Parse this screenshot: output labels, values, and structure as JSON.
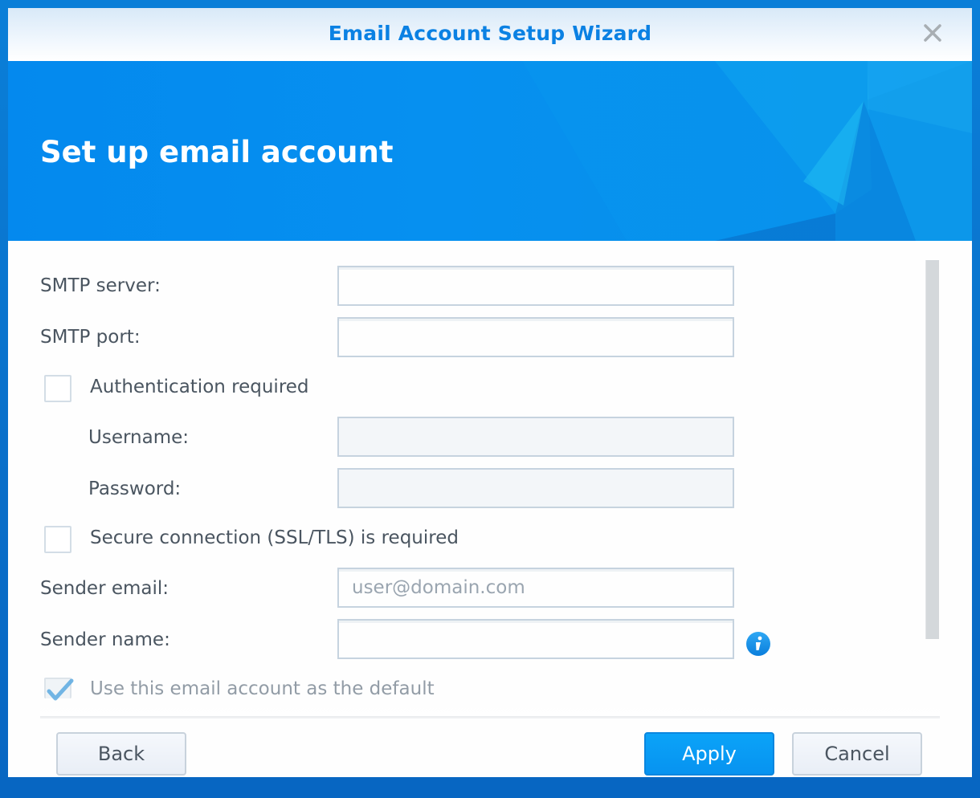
{
  "window": {
    "title": "Email Account Setup Wizard",
    "close_icon": "close-icon"
  },
  "banner": {
    "heading": "Set up email account"
  },
  "form": {
    "smtp_server": {
      "label": "SMTP server:",
      "value": "",
      "placeholder": ""
    },
    "smtp_port": {
      "label": "SMTP port:",
      "value": "",
      "placeholder": ""
    },
    "auth_required": {
      "label": "Authentication required",
      "checked": false
    },
    "username": {
      "label": "Username:",
      "value": "",
      "disabled": true
    },
    "password": {
      "label": "Password:",
      "value": "",
      "disabled": true
    },
    "ssl_required": {
      "label": "Secure connection (SSL/TLS) is required",
      "checked": false
    },
    "sender_email": {
      "label": "Sender email:",
      "value": "",
      "placeholder": "user@domain.com"
    },
    "sender_name": {
      "label": "Sender name:",
      "value": "",
      "placeholder": "",
      "info_icon": "info-icon"
    },
    "use_default": {
      "label": "Use this email account as the default",
      "checked": true,
      "disabled": true
    }
  },
  "footer": {
    "back_label": "Back",
    "apply_label": "Apply",
    "cancel_label": "Cancel"
  },
  "colors": {
    "accent": "#0b81e3",
    "banner": "#0690f0",
    "primary_button": "#0793f0"
  }
}
